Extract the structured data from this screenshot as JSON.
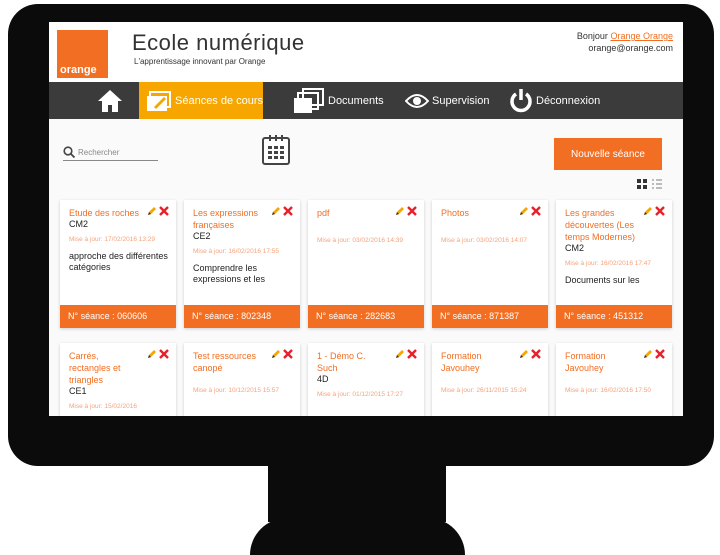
{
  "header": {
    "logo_text": "orange",
    "title": "Ecole numérique",
    "subtitle": "L'apprentissage innovant par Orange",
    "greeting": "Bonjour",
    "user_name": "Orange Orange",
    "user_email": "orange@orange.com"
  },
  "nav": {
    "items": [
      {
        "label": "Séances de cours",
        "icon": "folder-pencil-icon"
      },
      {
        "label": "Documents",
        "icon": "documents-icon"
      },
      {
        "label": "Supervision",
        "icon": "eye-icon"
      },
      {
        "label": "Déconnexion",
        "icon": "power-icon"
      }
    ]
  },
  "toolbar": {
    "search_placeholder": "Rechercher",
    "new_button": "Nouvelle séance"
  },
  "colors": {
    "accent": "#f26e22",
    "active_nav": "#f7a600",
    "nav_bg": "#3b3b3b"
  },
  "cards": [
    {
      "title": "Etude des roches",
      "level": "CM2",
      "date": "Mise à jour: 17/02/2016 13:29",
      "desc": "approche des différentes catégories",
      "number": "N° séance : 060606"
    },
    {
      "title": "Les expressions françaises",
      "level": "CE2",
      "date": "Mise à jour: 16/02/2016 17:55",
      "desc": "Comprendre les expressions et les",
      "number": "N° séance : 802348"
    },
    {
      "title": "pdf",
      "level": "",
      "date": "Mise à jour: 03/02/2016 14:39",
      "desc": "",
      "number": "N° séance : 282683"
    },
    {
      "title": "Photos",
      "level": "",
      "date": "Mise à jour: 03/02/2016 14:07",
      "desc": "",
      "number": "N° séance : 871387"
    },
    {
      "title": "Les grandes découvertes (Les temps Modernes)",
      "level": "CM2",
      "date": "Mise à jour: 16/02/2016 17:47",
      "desc": "Documents sur les",
      "number": "N° séance : 451312"
    },
    {
      "title": "Carrés, rectangles et triangles",
      "level": "CE1",
      "date": "Mise à jour: 15/02/2016",
      "desc": "",
      "number": ""
    },
    {
      "title": "Test ressources canopé",
      "level": "",
      "date": "Mise à jour: 10/12/2015 15:57",
      "desc": "",
      "number": ""
    },
    {
      "title": "1 - Démo C. Such",
      "level": "4D",
      "date": "Mise à jour: 01/12/2015 17:27",
      "desc": "",
      "number": ""
    },
    {
      "title": "Formation Javouhey",
      "level": "",
      "date": "Mise à jour: 26/11/2015 15:24",
      "desc": "",
      "number": ""
    },
    {
      "title": "Formation Javouhey",
      "level": "",
      "date": "Mise à jour: 16/02/2016 17:50",
      "desc": "",
      "number": ""
    }
  ]
}
